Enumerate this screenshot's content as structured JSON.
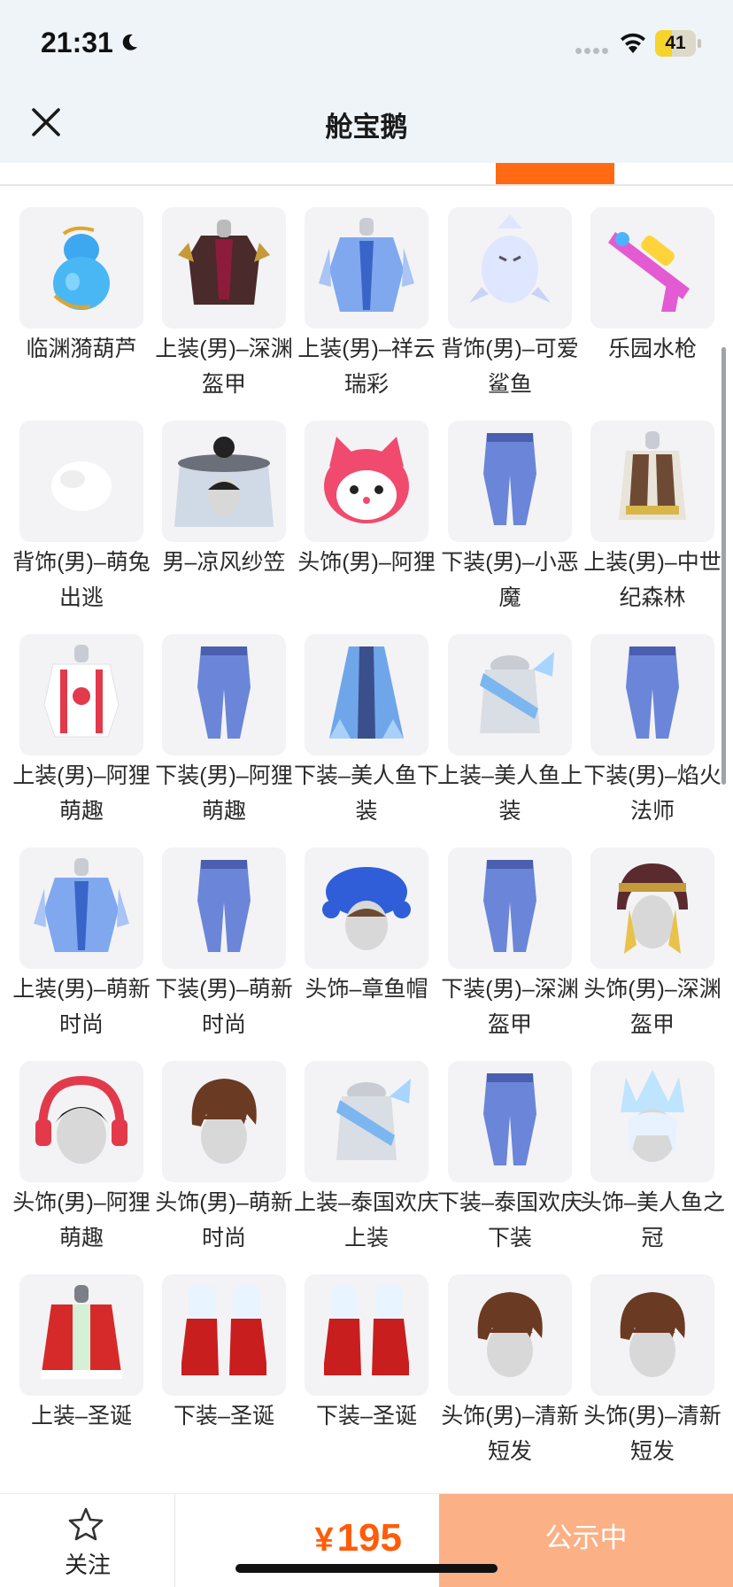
{
  "status_bar": {
    "time": "21:31",
    "battery": "41",
    "battery_level": 0.41,
    "icons": [
      "moon-icon",
      "signal-icon",
      "wifi-icon",
      "battery-icon"
    ]
  },
  "nav": {
    "title": "舱宝鹅",
    "close_icon": "close-icon"
  },
  "colors": {
    "accent": "#ff6a12",
    "price": "#ff5c0a",
    "status_button": "#fbb085",
    "thumb_bg": "#f3f3f5",
    "top_bg": "#eef4f8"
  },
  "items": [
    {
      "label": "临渊漪葫芦",
      "icon": "gourd-icon"
    },
    {
      "label": "上装(男)–深渊盔甲",
      "icon": "armor-icon"
    },
    {
      "label": "上装(男)–祥云瑞彩",
      "icon": "robe-icon"
    },
    {
      "label": "背饰(男)–可爱鲨鱼",
      "icon": "shark-icon"
    },
    {
      "label": "乐园水枪",
      "icon": "water-gun-icon"
    },
    {
      "label": "背饰(男)–萌兔出逃",
      "icon": "bunny-tail-icon"
    },
    {
      "label": "男–凉风纱笠",
      "icon": "veil-hat-icon"
    },
    {
      "label": "头饰(男)–阿狸",
      "icon": "fox-head-icon"
    },
    {
      "label": "下装(男)–小恶魔",
      "icon": "pants-icon"
    },
    {
      "label": "上装(男)–中世纪森林",
      "icon": "vest-icon"
    },
    {
      "label": "上装(男)–阿狸萌趣",
      "icon": "jacket-icon"
    },
    {
      "label": "下装(男)–阿狸萌趣",
      "icon": "pants-icon"
    },
    {
      "label": "下装–美人鱼下装",
      "icon": "skirt-icon"
    },
    {
      "label": "上装–美人鱼上装",
      "icon": "shirt-icon"
    },
    {
      "label": "下装(男)–焰火法师",
      "icon": "pants-icon"
    },
    {
      "label": "上装(男)–萌新时尚",
      "icon": "robe-icon"
    },
    {
      "label": "下装(男)–萌新时尚",
      "icon": "pants-icon"
    },
    {
      "label": "头饰–章鱼帽",
      "icon": "octopus-hat-icon"
    },
    {
      "label": "下装(男)–深渊盔甲",
      "icon": "pants-icon"
    },
    {
      "label": "头饰(男)–深渊盔甲",
      "icon": "helmet-icon"
    },
    {
      "label": "头饰(男)–阿狸萌趣",
      "icon": "headphones-icon"
    },
    {
      "label": "头饰(男)–萌新时尚",
      "icon": "hair-icon"
    },
    {
      "label": "上装–泰国欢庆上装",
      "icon": "shirt-icon"
    },
    {
      "label": "下装–泰国欢庆下装",
      "icon": "pants-icon"
    },
    {
      "label": "头饰–美人鱼之冠",
      "icon": "crown-icon"
    },
    {
      "label": "上装–圣诞",
      "icon": "coat-icon"
    },
    {
      "label": "下装–圣诞",
      "icon": "boots-icon"
    },
    {
      "label": "下装–圣诞",
      "icon": "boots-icon"
    },
    {
      "label": "头饰(男)–清新短发",
      "icon": "hair-icon"
    },
    {
      "label": "头饰(男)–清新短发",
      "icon": "hair-icon"
    }
  ],
  "bottom": {
    "follow_label": "关注",
    "follow_icon": "star-icon",
    "price_symbol": "¥",
    "price": "195",
    "status_label": "公示中"
  }
}
